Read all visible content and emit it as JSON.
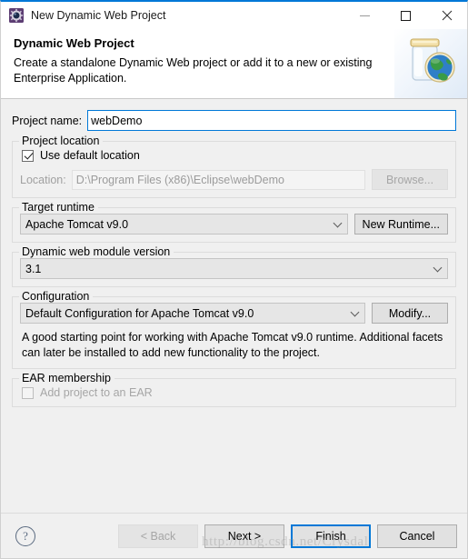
{
  "window": {
    "title": "New Dynamic Web Project",
    "icon": "eclipse-project-icon",
    "minimize_label": "–",
    "maximize_label": "□",
    "close_label": "✕"
  },
  "header": {
    "title": "Dynamic Web Project",
    "description": "Create a standalone Dynamic Web project or add it to a new or existing Enterprise Application.",
    "art": "jar-with-globe-icon"
  },
  "form": {
    "project_name": {
      "label": "Project name:",
      "value": "webDemo",
      "placeholder": ""
    },
    "project_location": {
      "group_title": "Project location",
      "use_default_label": "Use default location",
      "use_default_checked": true,
      "location_label": "Location:",
      "location_value": "D:\\Program Files (x86)\\Eclipse\\webDemo",
      "browse_label": "Browse...",
      "browse_enabled": false
    },
    "target_runtime": {
      "group_title": "Target runtime",
      "selected": "Apache Tomcat v9.0",
      "new_runtime_label": "New Runtime..."
    },
    "module_version": {
      "group_title": "Dynamic web module version",
      "selected": "3.1"
    },
    "configuration": {
      "group_title": "Configuration",
      "selected": "Default Configuration for Apache Tomcat v9.0",
      "modify_label": "Modify...",
      "description": "A good starting point for working with Apache Tomcat v9.0 runtime. Additional facets can later be installed to add new functionality to the project."
    },
    "ear_membership": {
      "group_title": "EAR membership",
      "add_project_label": "Add project to an EAR",
      "add_project_checked": false,
      "enabled": false
    }
  },
  "footer": {
    "help_label": "?",
    "back_label": "< Back",
    "back_enabled": false,
    "next_label": "Next >",
    "finish_label": "Finish",
    "cancel_label": "Cancel",
    "default_button": "Finish"
  },
  "watermark": {
    "text": "http://blog.csdn.net/Crysdal"
  },
  "colors": {
    "accent": "#0078d7",
    "dialog_bg": "#f0f0f0",
    "header_bg": "#ffffff",
    "disabled_text": "#a6a6a6"
  }
}
